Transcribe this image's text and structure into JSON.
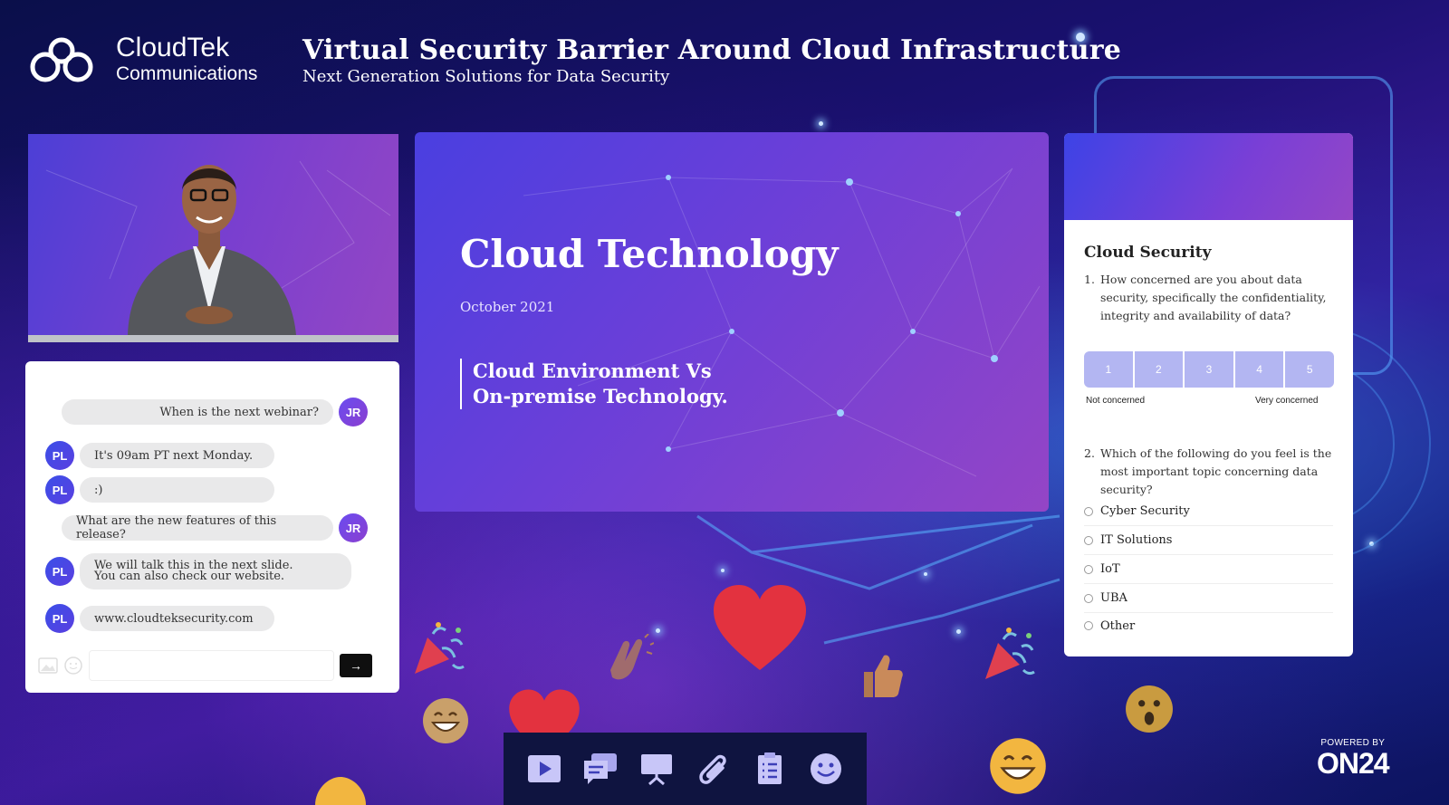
{
  "brand": {
    "name": "CloudTek",
    "sub": "Communications"
  },
  "header": {
    "title": "Virtual Security Barrier Around Cloud Infrastructure",
    "subtitle": "Next Generation Solutions for Data Security"
  },
  "chat": {
    "messages": [
      {
        "from": "JR",
        "text": "When is the next webinar?"
      },
      {
        "from": "PL",
        "text": "It's 09am PT next Monday."
      },
      {
        "from": "PL",
        "text": ":)"
      },
      {
        "from": "JR",
        "text": "What are the new features of this release?"
      },
      {
        "from": "PL",
        "text": "We will talk this in the next slide.",
        "text2": "You can also check our website."
      },
      {
        "from": "PL",
        "text": "www.cloudteksecurity.com"
      }
    ],
    "send_label": "→"
  },
  "slide": {
    "title": "Cloud Technology",
    "date": "October 2021",
    "subtitle_line1": "Cloud Environment Vs",
    "subtitle_line2": "On-premise Technology."
  },
  "survey": {
    "title": "Cloud Security",
    "q1": {
      "num": "1.",
      "text": "How concerned are you about data security, specifically the confidentiality, integrity and availability of data?"
    },
    "scale": [
      "1",
      "2",
      "3",
      "4",
      "5"
    ],
    "scale_low": "Not concerned",
    "scale_high": "Very concerned",
    "q2": {
      "num": "2.",
      "text": "Which of the following do you feel is the most important topic concerning data security?"
    },
    "options": [
      "Cyber Security",
      "IT Solutions",
      "IoT",
      "UBA",
      "Other"
    ]
  },
  "toolbar": {
    "icons": [
      "play-icon",
      "chat-icon",
      "presentation-icon",
      "attachment-icon",
      "survey-icon",
      "emoji-icon"
    ]
  },
  "powered": {
    "label": "POWERED BY",
    "brand": "ON24"
  },
  "colors": {
    "accent": "#5a3fe0",
    "heart": "#e3323f",
    "emoji": "#f2b640"
  }
}
